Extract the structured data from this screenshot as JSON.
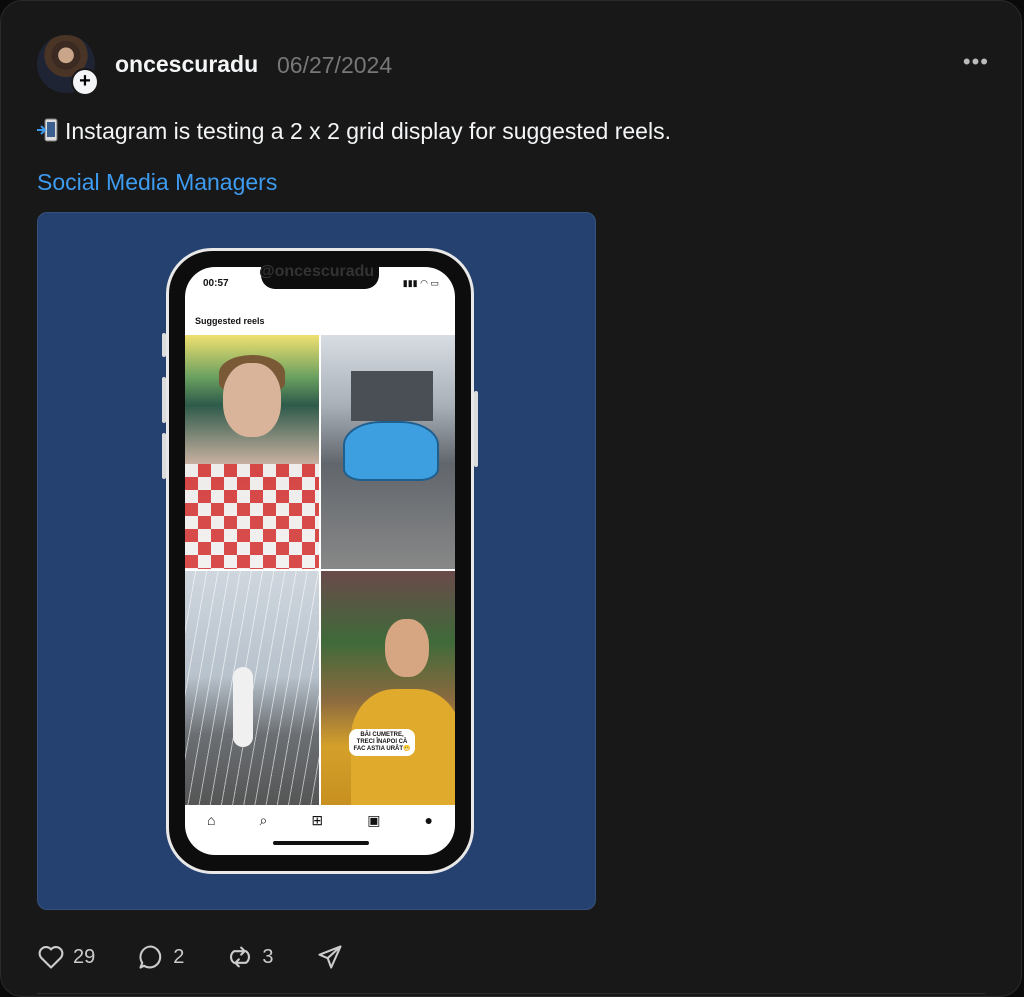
{
  "post": {
    "username": "oncescuradu",
    "date": "06/27/2024",
    "more_label": "•••",
    "text": "Instagram is testing a 2 x 2 grid display for suggested reels.",
    "topic": "Social Media Managers"
  },
  "image": {
    "watermark": "@oncescuradu",
    "status_time": "00:57",
    "section_label": "Suggested reels",
    "bubble_text": "BĂI CUMETRE, TRECI ÎNAPOI CĂ FAC ASTIA URÂT😬"
  },
  "actions": {
    "likes": "29",
    "replies": "2",
    "reposts": "3"
  },
  "colors": {
    "background": "#181818",
    "topic": "#3d9bf0",
    "media_bg": "#244170"
  },
  "icons": [
    "plus-icon",
    "more-icon",
    "phone-emoji-icon",
    "home-icon",
    "search-icon",
    "create-icon",
    "reels-icon",
    "profile-icon",
    "heart-icon",
    "comment-icon",
    "repost-icon",
    "share-icon"
  ]
}
